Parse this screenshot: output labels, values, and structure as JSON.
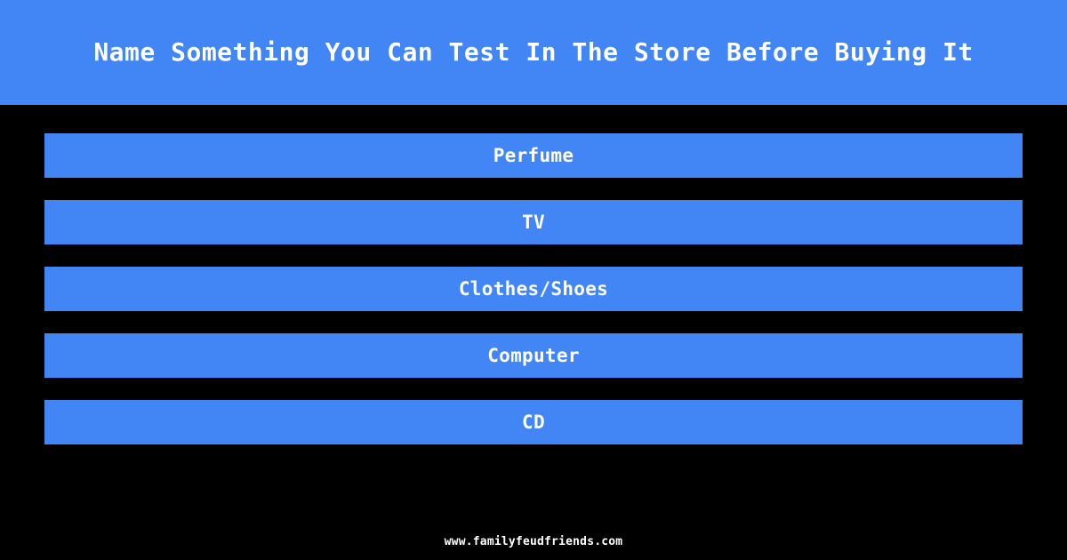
{
  "header": {
    "title": "Name Something You Can Test In The Store Before Buying It",
    "background_color": "#4285f4",
    "text_color": "#ffffff"
  },
  "answers": {
    "bar_color": "#4285f4",
    "text_color": "#ffffff",
    "items": [
      {
        "label": "Perfume"
      },
      {
        "label": "TV"
      },
      {
        "label": "Clothes/Shoes"
      },
      {
        "label": "Computer"
      },
      {
        "label": "CD"
      }
    ]
  },
  "footer": {
    "site": "www.familyfeudfriends.com",
    "text_color": "#ffffff"
  },
  "page": {
    "background_color": "#000000"
  }
}
